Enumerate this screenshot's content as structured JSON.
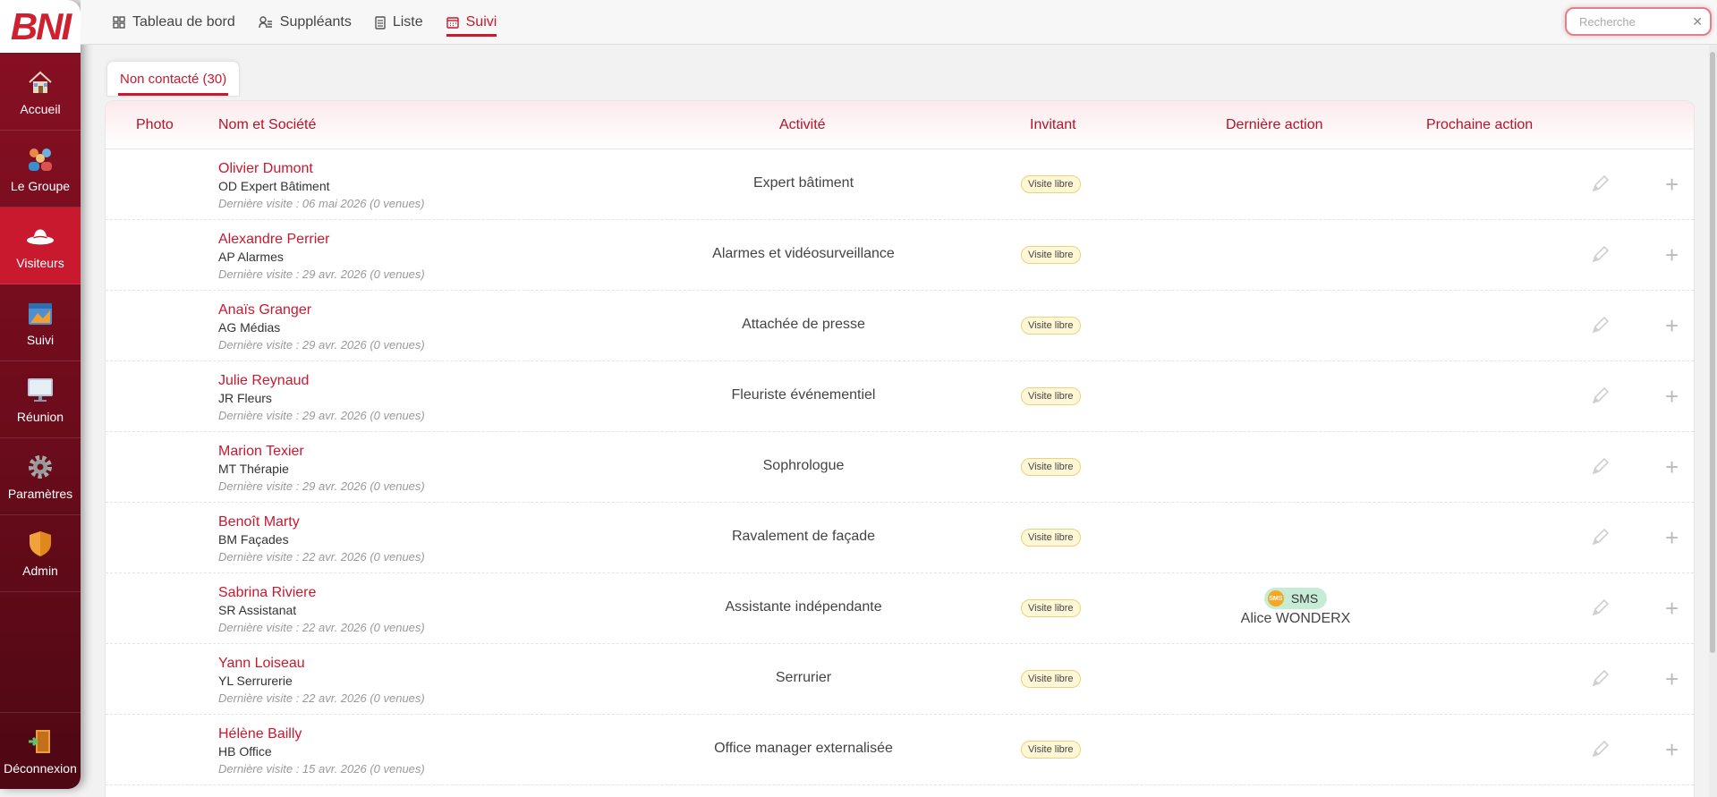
{
  "brand": "BNI",
  "sidebar": {
    "items": [
      {
        "label": "Accueil",
        "icon": "home-icon"
      },
      {
        "label": "Le Groupe",
        "icon": "group-icon"
      },
      {
        "label": "Visiteurs",
        "icon": "visitors-hat-icon",
        "active": true
      },
      {
        "label": "Suivi",
        "icon": "calendar-icon"
      },
      {
        "label": "Réunion",
        "icon": "monitor-icon"
      },
      {
        "label": "Paramètres",
        "icon": "gear-icon"
      },
      {
        "label": "Admin",
        "icon": "shield-icon"
      }
    ],
    "logout_label": "Déconnexion"
  },
  "topbar": {
    "tabs": [
      {
        "label": "Tableau de bord",
        "icon": "dashboard-icon"
      },
      {
        "label": "Suppléants",
        "icon": "substitutes-icon"
      },
      {
        "label": "Liste",
        "icon": "list-icon"
      },
      {
        "label": "Suivi",
        "icon": "calendar-icon",
        "active": true
      }
    ],
    "search_placeholder": "Recherche"
  },
  "filter": {
    "label": "Non contacté (30)"
  },
  "table": {
    "headers": {
      "photo": "Photo",
      "name": "Nom et Société",
      "activity": "Activité",
      "inviter": "Invitant",
      "last_action": "Dernière action",
      "next_action": "Prochaine action"
    },
    "rows": [
      {
        "name": "Olivier Dumont",
        "company": "OD Expert Bâtiment",
        "last_visit": "Dernière visite : 06 mai 2026 (0 venues)",
        "activity": "Expert bâtiment",
        "inviter": "Visite libre"
      },
      {
        "name": "Alexandre Perrier",
        "company": "AP Alarmes",
        "last_visit": "Dernière visite : 29 avr. 2026 (0 venues)",
        "activity": "Alarmes et vidéosurveillance",
        "inviter": "Visite libre"
      },
      {
        "name": "Anaïs Granger",
        "company": "AG Médias",
        "last_visit": "Dernière visite : 29 avr. 2026 (0 venues)",
        "activity": "Attachée de presse",
        "inviter": "Visite libre"
      },
      {
        "name": "Julie Reynaud",
        "company": "JR Fleurs",
        "last_visit": "Dernière visite : 29 avr. 2026 (0 venues)",
        "activity": "Fleuriste événementiel",
        "inviter": "Visite libre"
      },
      {
        "name": "Marion Texier",
        "company": "MT Thérapie",
        "last_visit": "Dernière visite : 29 avr. 2026 (0 venues)",
        "activity": "Sophrologue",
        "inviter": "Visite libre"
      },
      {
        "name": "Benoît Marty",
        "company": "BM Façades",
        "last_visit": "Dernière visite : 22 avr. 2026 (0 venues)",
        "activity": "Ravalement de façade",
        "inviter": "Visite libre"
      },
      {
        "name": "Sabrina Riviere",
        "company": "SR Assistanat",
        "last_visit": "Dernière visite : 22 avr. 2026 (0 venues)",
        "activity": "Assistante indépendante",
        "inviter": "Visite libre",
        "last_action": {
          "type": "SMS",
          "user": "Alice WONDERX"
        }
      },
      {
        "name": "Yann Loiseau",
        "company": "YL Serrurerie",
        "last_visit": "Dernière visite : 22 avr. 2026 (0 venues)",
        "activity": "Serrurier",
        "inviter": "Visite libre"
      },
      {
        "name": "Hélène Bailly",
        "company": "HB Office",
        "last_visit": "Dernière visite : 15 avr. 2026 (0 venues)",
        "activity": "Office manager externalisée",
        "inviter": "Visite libre"
      }
    ]
  },
  "colors": {
    "brand_red": "#c8192f",
    "sidebar_dark": "#6e0c1c",
    "badge_bg": "#fff7d6",
    "sms_bg": "#c7ecd6"
  }
}
